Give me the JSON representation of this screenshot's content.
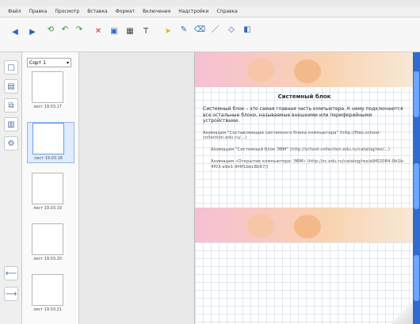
{
  "menu": {
    "items": [
      "Файл",
      "Правка",
      "Просмотр",
      "Вставка",
      "Формат",
      "Включения",
      "Надстройки",
      "Справка"
    ]
  },
  "toolbar": {
    "icons": [
      "back-icon",
      "forward-icon",
      "new-page-icon",
      "undo-icon",
      "redo-icon",
      "delete-icon",
      "screen-shade-icon",
      "table-icon",
      "text-icon",
      "pointer-icon",
      "pen-icon",
      "eraser-icon",
      "line-icon",
      "shape-icon",
      "fill-icon"
    ]
  },
  "sidebar": {
    "page_sort": "Сорт 1",
    "thumbnails": [
      {
        "label": "лист 19.03.17"
      },
      {
        "label": "лист 19.03.18"
      },
      {
        "label": "лист 19.03.19"
      },
      {
        "label": "лист 19.03.20"
      },
      {
        "label": "лист 19.03.21"
      }
    ]
  },
  "slide": {
    "title": "Системный блок",
    "paragraph1": "Системный блок – это самая главная часть компьютера. К нему подключаются все остальные блоки, называемые внешними или периферийными устройствами.",
    "paragraph2": "Анимация \"Составляющие системного блока компьютера\" (http://files.school-collection.edu.ru/...)",
    "paragraph3": "Анимация \"Системный блок ЭВМ\" (http://school-collection.edu.ru/catalog/res/...)",
    "paragraph4": "Анимация «Открытие компьютера: ЭВМ» (http://sc.edu.ru/catalog/res/a9f02084-0b1b-4f03-a9e1-9f4f1bbc8b67/)"
  }
}
